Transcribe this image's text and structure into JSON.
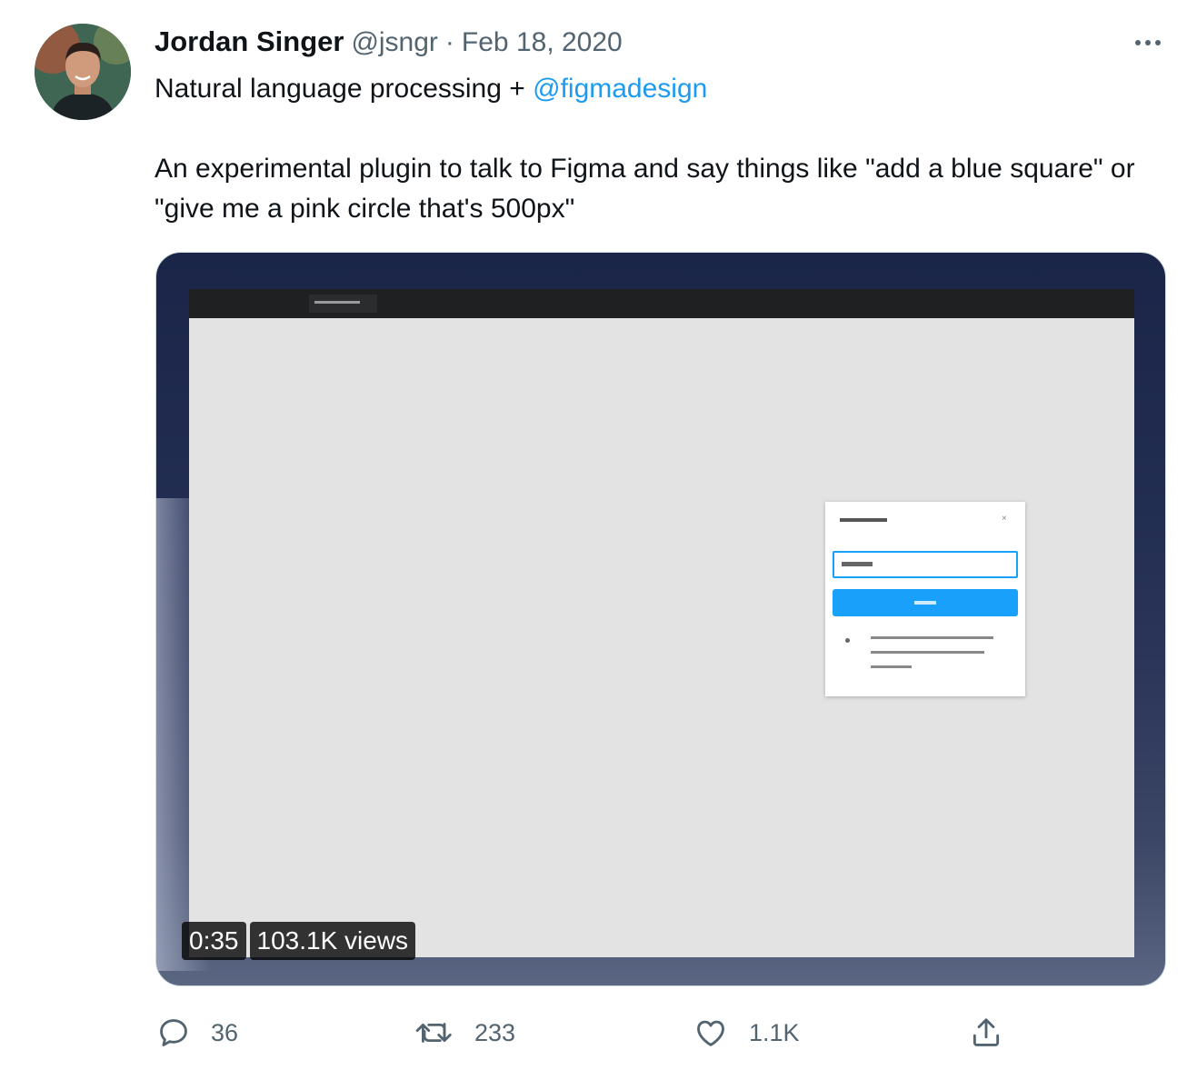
{
  "author": {
    "name": "Jordan Singer",
    "handle": "@jsngr",
    "separator": "·",
    "date": "Feb 18, 2020"
  },
  "tweet": {
    "line1_text": "Natural language processing + ",
    "line1_mention": "@figmadesign",
    "line2": "An experimental plugin to talk to Figma and say things like \"add a blue square\" or \"give me a pink circle that's 500px\""
  },
  "video": {
    "duration": "0:35",
    "views": "103.1K views"
  },
  "actions": {
    "replies": "36",
    "retweets": "233",
    "likes": "1.1K"
  },
  "icons": {
    "more": "more-options-icon",
    "reply": "reply-icon",
    "retweet": "retweet-icon",
    "like": "heart-icon",
    "share": "share-icon"
  },
  "colors": {
    "text": "#0f1419",
    "secondary": "#536471",
    "link": "#1d9bf0",
    "figma_blue": "#18a0fb"
  }
}
